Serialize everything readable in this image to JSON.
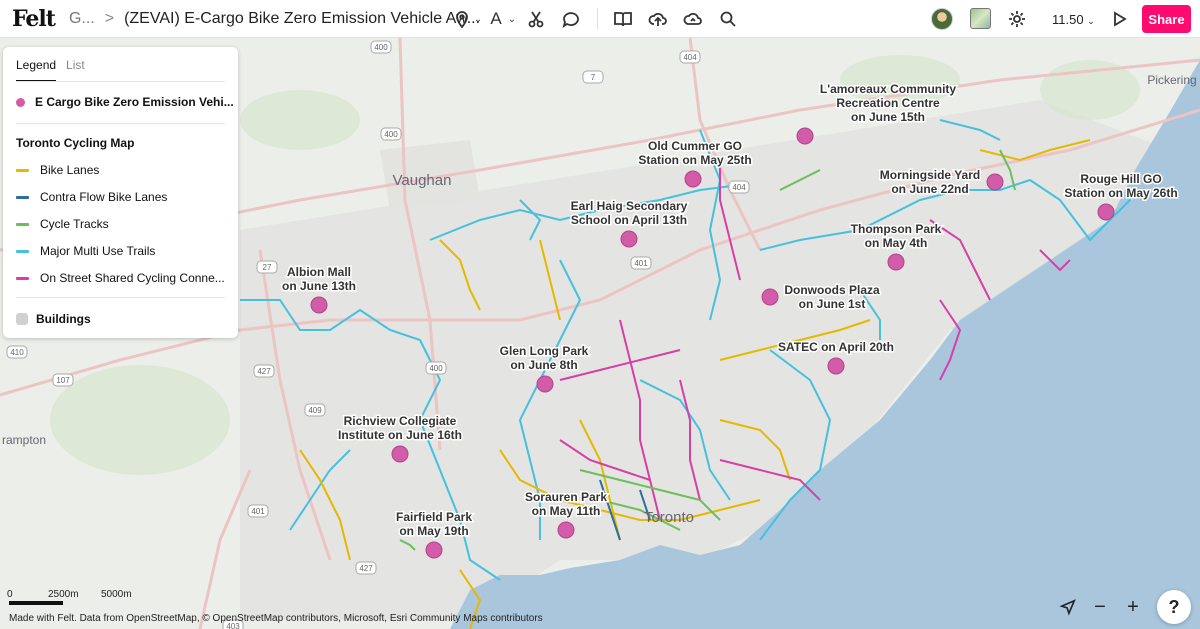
{
  "app": {
    "logo": "Felt",
    "breadcrumb": "G...",
    "breadcrumb_sep": ">",
    "title": "(ZEVAI) E-Cargo Bike Zero Emission Vehicle Aw..."
  },
  "toolbar": {
    "icons": [
      "pin-icon",
      "chevron-down-icon",
      "text-icon",
      "chevron-down-icon",
      "scissors-icon",
      "comment-icon",
      "book-icon",
      "upload-icon",
      "cloud-upload-icon",
      "search-icon"
    ],
    "zoom_label": "11.50",
    "zoom_chevron": "⌄",
    "share_label": "Share",
    "share_color": "#ff0a6e"
  },
  "legend": {
    "tabs": [
      "Legend",
      "List"
    ],
    "event_layer": {
      "label": "E Cargo Bike Zero Emission Vehi...",
      "color": "#d35ca8"
    },
    "group_title": "Toronto Cycling Map",
    "items": [
      {
        "label": "Bike Lanes",
        "color": "#e6b800"
      },
      {
        "label": "Contra Flow Bike Lanes",
        "color": "#2b6f9e"
      },
      {
        "label": "Cycle Tracks",
        "color": "#6abf5a"
      },
      {
        "label": "Major Multi Use Trails",
        "color": "#45c1de"
      },
      {
        "label": "On Street Shared Cycling Conne...",
        "color": "#d640a6"
      }
    ],
    "buildings_label": "Buildings"
  },
  "map": {
    "places": [
      "Vaughan",
      "Toronto",
      "Pickering",
      "rampton"
    ],
    "highway_shields": [
      "400",
      "404",
      "7",
      "400",
      "404",
      "401",
      "27",
      "410",
      "427",
      "400",
      "107",
      "409",
      "401",
      "427",
      "403"
    ],
    "events": [
      {
        "label": "L'amoreaux Community\nRecreation Centre\non June 15th"
      },
      {
        "label": "Old Cummer GO\nStation on May 25th"
      },
      {
        "label": "Morningside Yard\non June 22nd"
      },
      {
        "label": "Rouge Hill GO\nStation on May 26th"
      },
      {
        "label": "Earl Haig Secondary\nSchool on April 13th"
      },
      {
        "label": "Thompson Park\non May 4th"
      },
      {
        "label": "Albion Mall\non June 13th"
      },
      {
        "label": "Donwoods Plaza\non June 1st"
      },
      {
        "label": "SATEC on April 20th"
      },
      {
        "label": "Glen Long Park\non June 8th"
      },
      {
        "label": "Richview Collegiate\nInstitute on June 16th"
      },
      {
        "label": "Sorauren Park\non May 11th"
      },
      {
        "label": "Fairfield Park\non May 19th"
      }
    ],
    "lake_color": "#a9c6dd"
  },
  "scale": {
    "labels": [
      "0",
      "2500m",
      "5000m"
    ]
  },
  "attribution": "Made with Felt. Data from OpenStreetMap, © OpenStreetMap contributors, Microsoft, Esri Community Maps contributors",
  "controls": {
    "locate_icon": "locate-icon",
    "zoom_out": "−",
    "zoom_in": "+",
    "help": "?"
  }
}
